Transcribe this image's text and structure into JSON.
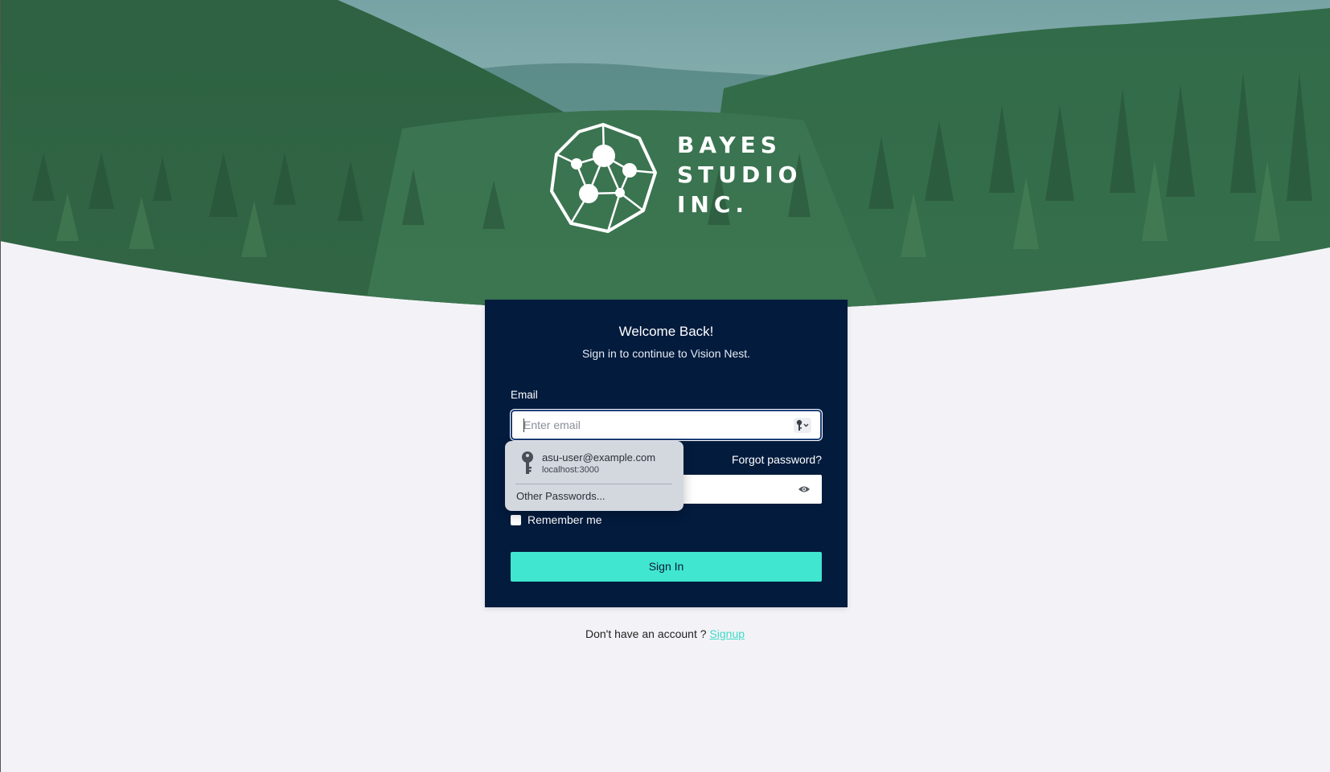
{
  "brand": {
    "line1": "BAYES",
    "line2": "STUDIO",
    "line3": "INC."
  },
  "card": {
    "title": "Welcome Back!",
    "subtitle": "Sign in to continue to Vision Nest."
  },
  "form": {
    "email_label": "Email",
    "email_placeholder": "Enter email",
    "email_value": "",
    "forgot_password": "Forgot password?",
    "password_value": "",
    "remember_label": "Remember me",
    "remember_checked": false,
    "signin_label": "Sign In"
  },
  "autofill": {
    "username": "asu-user@example.com",
    "site": "localhost:3000",
    "other": "Other Passwords..."
  },
  "footer": {
    "prompt": "Don't have an account ?",
    "signup": "Signup"
  },
  "colors": {
    "card_bg": "#031b3d",
    "accent": "#40e6d0",
    "page_bg": "#f3f3f7"
  },
  "icons": {
    "logo": "bayes-logo-icon",
    "key": "key-icon",
    "eye": "eye-icon"
  }
}
